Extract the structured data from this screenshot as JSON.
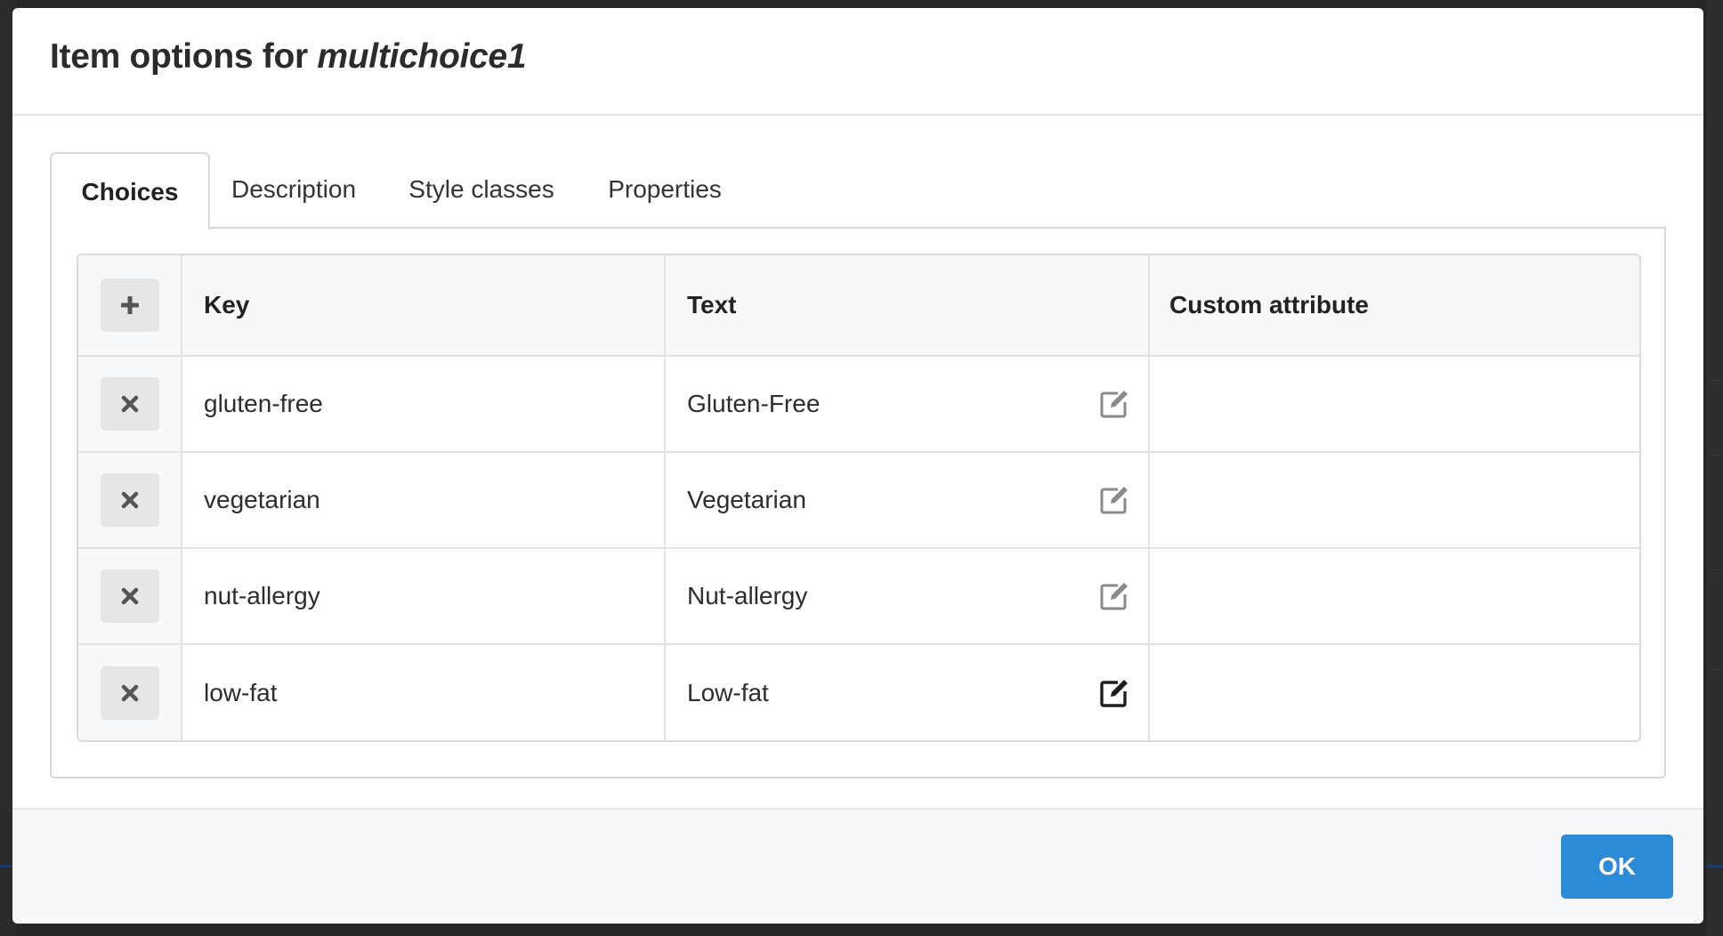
{
  "dialog": {
    "title_prefix": "Item options for",
    "item_name": "multichoice1"
  },
  "tabs": [
    {
      "label": "Choices",
      "active": true
    },
    {
      "label": "Description",
      "active": false
    },
    {
      "label": "Style classes",
      "active": false
    },
    {
      "label": "Properties",
      "active": false
    }
  ],
  "table": {
    "columns": [
      "Key",
      "Text",
      "Custom attribute"
    ],
    "add_button_icon": "plus-icon",
    "remove_button_icon": "close-icon",
    "edit_icon": "edit-icon",
    "rows": [
      {
        "key": "gluten-free",
        "text": "Gluten-Free",
        "custom_attribute": ""
      },
      {
        "key": "vegetarian",
        "text": "Vegetarian",
        "custom_attribute": ""
      },
      {
        "key": "nut-allergy",
        "text": "Nut-allergy",
        "custom_attribute": ""
      },
      {
        "key": "low-fat",
        "text": "Low-fat",
        "custom_attribute": "",
        "edit_active": true
      }
    ]
  },
  "footer": {
    "ok_label": "OK"
  },
  "colors": {
    "primary_button": "#2b8bd6",
    "icon_muted": "#8a8a8a",
    "icon_active": "#1e1e1e"
  }
}
